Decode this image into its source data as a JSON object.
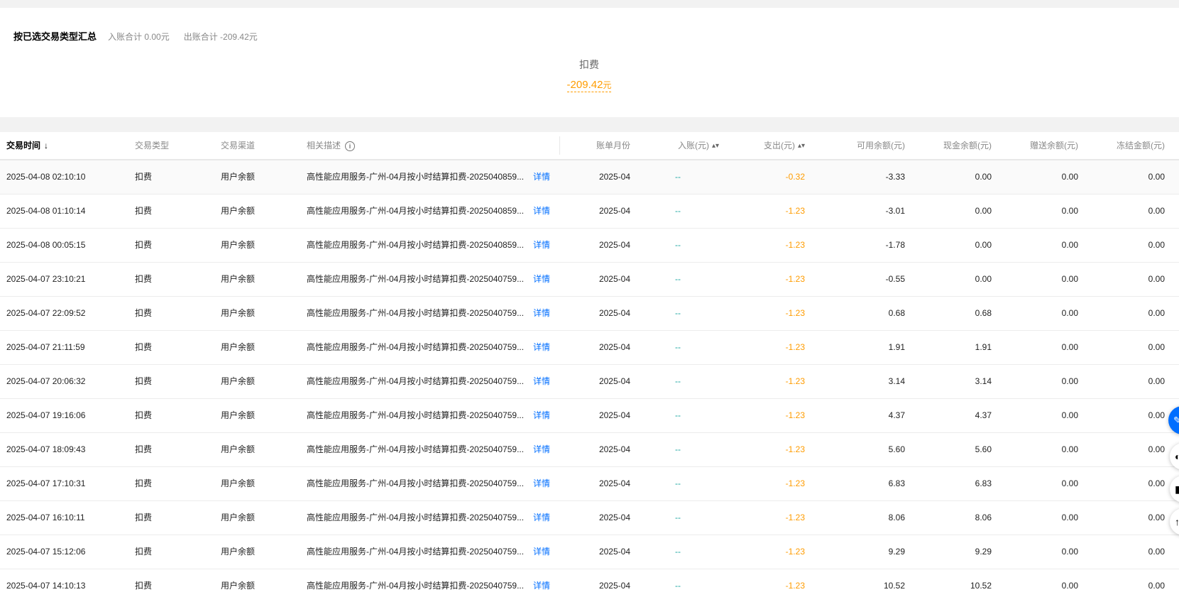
{
  "summary": {
    "title": "按已选交易类型汇总",
    "in_total": "入账合计 0.00元",
    "out_total": "出账合计 -209.42元",
    "card": {
      "label": "扣费",
      "amount": "-209.42",
      "unit": "元"
    }
  },
  "table": {
    "columns": {
      "time": "交易时间",
      "type": "交易类型",
      "channel": "交易渠道",
      "desc": "相关描述",
      "month": "账单月份",
      "income": "入账(元)",
      "expense": "支出(元)",
      "available": "可用余额(元)",
      "cash": "现金余额(元)",
      "gift": "赠送余额(元)",
      "frozen": "冻结金额(元)"
    },
    "icons": {
      "time_sort": "arrow-down-icon",
      "desc_info": "info-icon",
      "sort": "sort-icon"
    },
    "detail_label": "详情",
    "rows": [
      {
        "time": "2025-04-08 02:10:10",
        "type": "扣费",
        "channel": "用户余额",
        "desc": "高性能应用服务-广州-04月按小时结算扣费-2025040859...",
        "month": "2025-04",
        "income": "--",
        "expense": "-0.32",
        "available": "-3.33",
        "cash": "0.00",
        "gift": "0.00",
        "frozen": "0.00"
      },
      {
        "time": "2025-04-08 01:10:14",
        "type": "扣费",
        "channel": "用户余额",
        "desc": "高性能应用服务-广州-04月按小时结算扣费-2025040859...",
        "month": "2025-04",
        "income": "--",
        "expense": "-1.23",
        "available": "-3.01",
        "cash": "0.00",
        "gift": "0.00",
        "frozen": "0.00"
      },
      {
        "time": "2025-04-08 00:05:15",
        "type": "扣费",
        "channel": "用户余额",
        "desc": "高性能应用服务-广州-04月按小时结算扣费-2025040859...",
        "month": "2025-04",
        "income": "--",
        "expense": "-1.23",
        "available": "-1.78",
        "cash": "0.00",
        "gift": "0.00",
        "frozen": "0.00"
      },
      {
        "time": "2025-04-07 23:10:21",
        "type": "扣费",
        "channel": "用户余额",
        "desc": "高性能应用服务-广州-04月按小时结算扣费-2025040759...",
        "month": "2025-04",
        "income": "--",
        "expense": "-1.23",
        "available": "-0.55",
        "cash": "0.00",
        "gift": "0.00",
        "frozen": "0.00"
      },
      {
        "time": "2025-04-07 22:09:52",
        "type": "扣费",
        "channel": "用户余额",
        "desc": "高性能应用服务-广州-04月按小时结算扣费-2025040759...",
        "month": "2025-04",
        "income": "--",
        "expense": "-1.23",
        "available": "0.68",
        "cash": "0.68",
        "gift": "0.00",
        "frozen": "0.00"
      },
      {
        "time": "2025-04-07 21:11:59",
        "type": "扣费",
        "channel": "用户余额",
        "desc": "高性能应用服务-广州-04月按小时结算扣费-2025040759...",
        "month": "2025-04",
        "income": "--",
        "expense": "-1.23",
        "available": "1.91",
        "cash": "1.91",
        "gift": "0.00",
        "frozen": "0.00"
      },
      {
        "time": "2025-04-07 20:06:32",
        "type": "扣费",
        "channel": "用户余额",
        "desc": "高性能应用服务-广州-04月按小时结算扣费-2025040759...",
        "month": "2025-04",
        "income": "--",
        "expense": "-1.23",
        "available": "3.14",
        "cash": "3.14",
        "gift": "0.00",
        "frozen": "0.00"
      },
      {
        "time": "2025-04-07 19:16:06",
        "type": "扣费",
        "channel": "用户余额",
        "desc": "高性能应用服务-广州-04月按小时结算扣费-2025040759...",
        "month": "2025-04",
        "income": "--",
        "expense": "-1.23",
        "available": "4.37",
        "cash": "4.37",
        "gift": "0.00",
        "frozen": "0.00"
      },
      {
        "time": "2025-04-07 18:09:43",
        "type": "扣费",
        "channel": "用户余额",
        "desc": "高性能应用服务-广州-04月按小时结算扣费-2025040759...",
        "month": "2025-04",
        "income": "--",
        "expense": "-1.23",
        "available": "5.60",
        "cash": "5.60",
        "gift": "0.00",
        "frozen": "0.00"
      },
      {
        "time": "2025-04-07 17:10:31",
        "type": "扣费",
        "channel": "用户余额",
        "desc": "高性能应用服务-广州-04月按小时结算扣费-2025040759...",
        "month": "2025-04",
        "income": "--",
        "expense": "-1.23",
        "available": "6.83",
        "cash": "6.83",
        "gift": "0.00",
        "frozen": "0.00"
      },
      {
        "time": "2025-04-07 16:10:11",
        "type": "扣费",
        "channel": "用户余额",
        "desc": "高性能应用服务-广州-04月按小时结算扣费-2025040759...",
        "month": "2025-04",
        "income": "--",
        "expense": "-1.23",
        "available": "8.06",
        "cash": "8.06",
        "gift": "0.00",
        "frozen": "0.00"
      },
      {
        "time": "2025-04-07 15:12:06",
        "type": "扣费",
        "channel": "用户余额",
        "desc": "高性能应用服务-广州-04月按小时结算扣费-2025040759...",
        "month": "2025-04",
        "income": "--",
        "expense": "-1.23",
        "available": "9.29",
        "cash": "9.29",
        "gift": "0.00",
        "frozen": "0.00"
      },
      {
        "time": "2025-04-07 14:10:13",
        "type": "扣费",
        "channel": "用户余额",
        "desc": "高性能应用服务-广州-04月按小时结算扣费-2025040759...",
        "month": "2025-04",
        "income": "--",
        "expense": "-1.23",
        "available": "10.52",
        "cash": "10.52",
        "gift": "0.00",
        "frozen": "0.00"
      }
    ]
  },
  "floating_buttons": {
    "primary_icon": "feedback-icon",
    "secondary_icons": [
      "tool-icon",
      "chat-icon",
      "scroll-top-icon"
    ]
  },
  "colors": {
    "accent": "#006eff",
    "expense": "#ff9c00",
    "income": "#1aa6a0"
  }
}
